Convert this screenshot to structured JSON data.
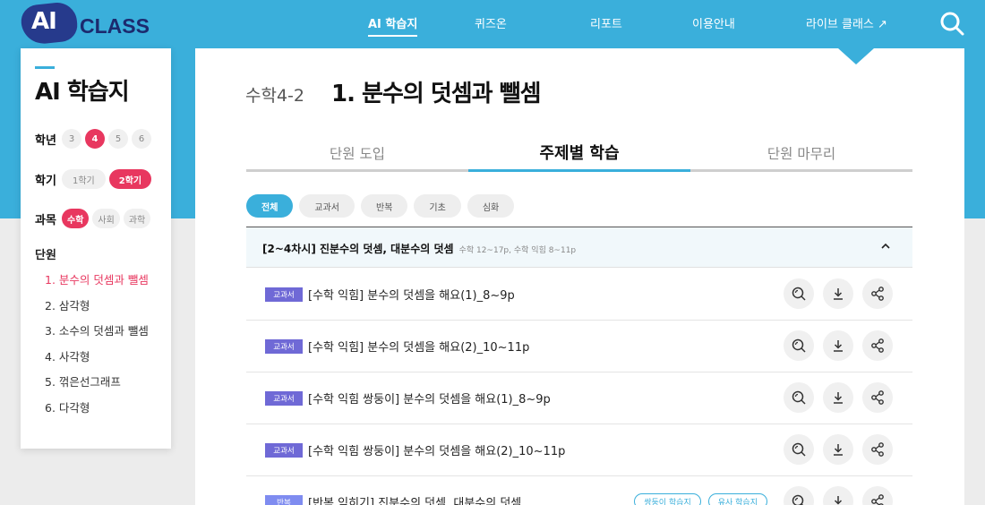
{
  "header": {
    "logo_ai": "AI",
    "logo_class": "CLASS",
    "nav": [
      "AI 학습지",
      "퀴즈온",
      "리포트",
      "이용안내",
      "라이브 클래스 ↗"
    ],
    "active_nav": "AI 학습지"
  },
  "sidebar": {
    "title": "AI 학습지",
    "grade_label": "학년",
    "grades": [
      "3",
      "4",
      "5",
      "6"
    ],
    "selected_grade": "4",
    "semester_label": "학기",
    "semesters": [
      "1학기",
      "2학기"
    ],
    "selected_semester": "2학기",
    "subject_label": "과목",
    "subjects": [
      "수학",
      "사회",
      "과학"
    ],
    "selected_subject": "수학",
    "unit_label": "단원",
    "units": [
      "1. 분수의 덧셈과 뺄셈",
      "2. 삼각형",
      "3. 소수의 덧셈과 뺄셈",
      "4. 사각형",
      "5. 꺾은선그래프",
      "6. 다각형"
    ],
    "selected_unit": "1. 분수의 덧셈과 뺄셈"
  },
  "main": {
    "subject": "수학4-2",
    "unit_title": "1. 분수의 덧셈과 뺄셈",
    "tabs": [
      "단원 도입",
      "주제별 학습",
      "단원 마무리"
    ],
    "active_tab": "주제별 학습",
    "filters": [
      "전체",
      "교과서",
      "반복",
      "기초",
      "심화"
    ],
    "active_filter": "전체",
    "group": {
      "title": "[2~4차시] 진분수의 덧셈, 대분수의 덧셈",
      "sub": "수학 12~17p, 수학 익힘 8~11p"
    },
    "rows": [
      {
        "badge": "교과서",
        "title": "[수학 익힘] 분수의 덧셈을 해요(1)_8~9p",
        "tags": []
      },
      {
        "badge": "교과서",
        "title": "[수학 익힘] 분수의 덧셈을 해요(2)_10~11p",
        "tags": []
      },
      {
        "badge": "교과서",
        "title": "[수학 익힘 쌍둥이] 분수의 덧셈을 해요(1)_8~9p",
        "tags": []
      },
      {
        "badge": "교과서",
        "title": "[수학 익힘 쌍둥이] 분수의 덧셈을 해요(2)_10~11p",
        "tags": []
      },
      {
        "badge": "반복",
        "title": "[반복 익히기] 진분수의 덧셈, 대분수의 덧셈",
        "tags": [
          "쌍둥이 학습지",
          "유사 학습지"
        ]
      }
    ]
  },
  "colors": {
    "brand_blue": "#3aafdb",
    "accent_pink": "#e8375f",
    "badge_purple": "#6f69d6",
    "logo_navy": "#1c2a6e"
  },
  "icons": [
    "search-icon",
    "chevron-up-icon",
    "preview-icon",
    "download-icon",
    "share-icon"
  ]
}
